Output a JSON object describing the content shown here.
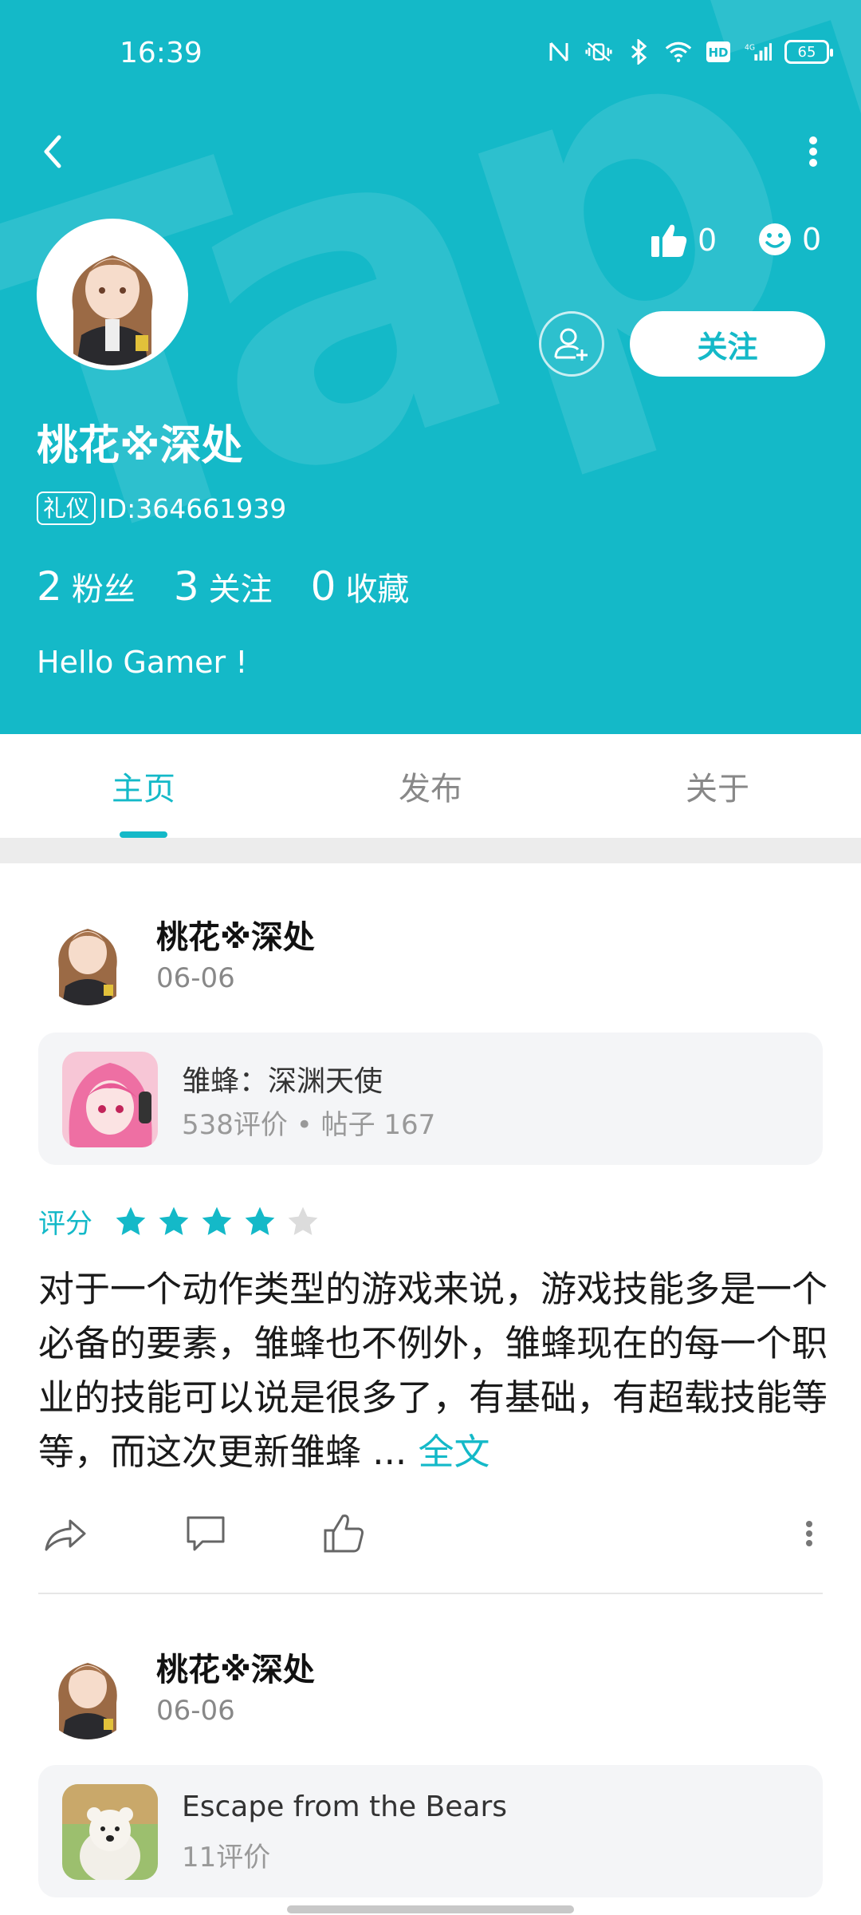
{
  "status_bar": {
    "time": "16:39",
    "battery": "65"
  },
  "profile": {
    "nickname": "桃花※深处",
    "badge": "礼仪",
    "id_text": "ID:364661939",
    "likes": "0",
    "smiles": "0",
    "follow_label": "关注",
    "counts": [
      {
        "num": "2",
        "label": "粉丝"
      },
      {
        "num": "3",
        "label": "关注"
      },
      {
        "num": "0",
        "label": "收藏"
      }
    ],
    "bio": "Hello Gamer !"
  },
  "tabs": [
    {
      "label": "主页",
      "active": true
    },
    {
      "label": "发布",
      "active": false
    },
    {
      "label": "关于",
      "active": false
    }
  ],
  "posts": [
    {
      "author": "桃花※深处",
      "date": "06-06",
      "game_name": "雏蜂：深渊天使",
      "game_meta": "538评价 • 帖子 167",
      "rating_label": "评分",
      "rating": 4,
      "rating_max": 5,
      "body": "对于一个动作类型的游戏来说，游戏技能多是一个必备的要素，雏蜂也不例外，雏蜂现在的每一个职业的技能可以说是很多了，有基础，有超载技能等等，而这次更新雏蜂 ... ",
      "fulltext_label": "全文"
    },
    {
      "author": "桃花※深处",
      "date": "06-06",
      "game_name": "Escape from the Bears",
      "game_meta": "11评价"
    }
  ],
  "colors": {
    "accent": "#14b9c8",
    "star_empty": "#dcdcdc"
  }
}
